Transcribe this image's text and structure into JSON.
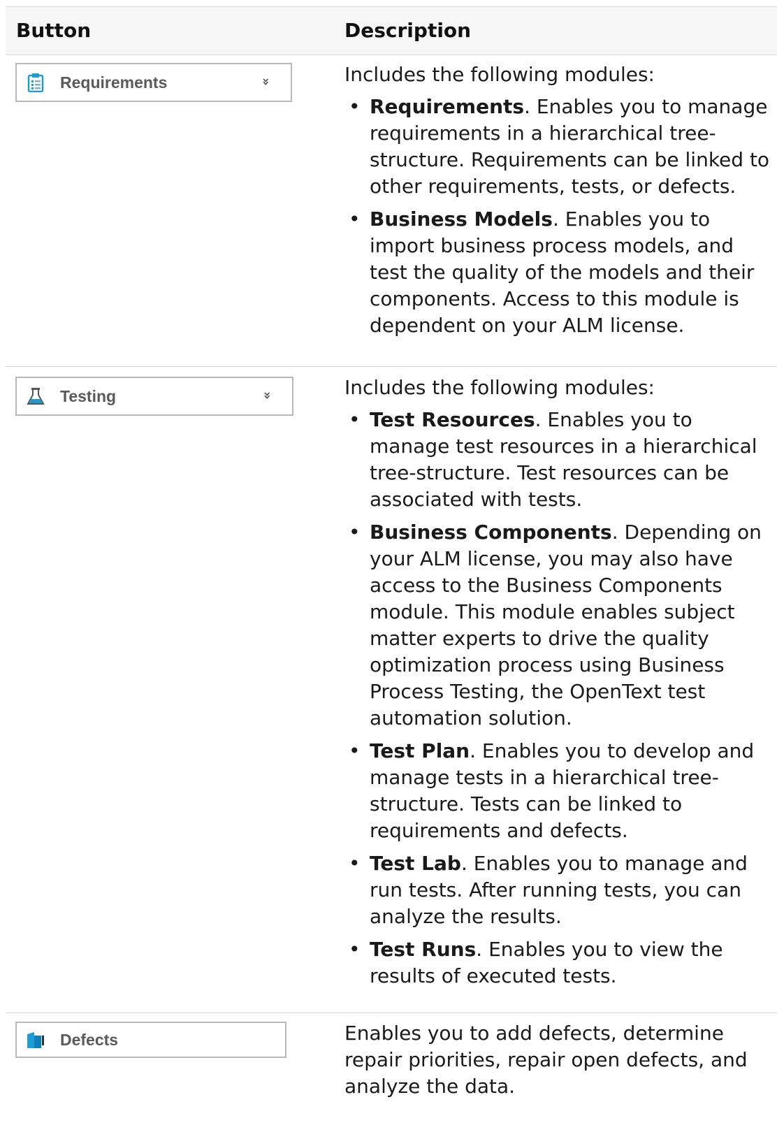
{
  "table": {
    "headers": {
      "button": "Button",
      "description": "Description"
    },
    "rows": [
      {
        "button": {
          "label": "Requirements",
          "icon": "requirements-icon",
          "has_chevron": true,
          "chevron": "»"
        },
        "intro": "Includes the following modules:",
        "items": [
          {
            "name": "Requirements",
            "text": ". Enables you to manage requirements in a hierarchical tree-structure. Requirements can be linked to other requirements, tests, or defects."
          },
          {
            "name": "Business Models",
            "text": ". Enables you to import business process models, and test the quality of the models and their components. Access to this module is dependent on your ALM license."
          }
        ]
      },
      {
        "button": {
          "label": "Testing",
          "icon": "testing-flask-icon",
          "has_chevron": true,
          "chevron": "»"
        },
        "intro": "Includes the following modules:",
        "items": [
          {
            "name": "Test Resources",
            "text": ". Enables you to manage test resources in a hierarchical tree-structure. Test resources can be associated with tests."
          },
          {
            "name": "Business Components",
            "text": ". Depending on your ALM license, you may also have access to the Business Components module. This module enables subject matter experts to drive the quality optimization process using Business Process Testing, the OpenText test automation solution."
          },
          {
            "name": "Test Plan",
            "text": ". Enables you to develop and manage tests in a hierarchical tree-structure. Tests can be linked to requirements and defects."
          },
          {
            "name": "Test Lab",
            "text": ". Enables you to manage and run tests. After running tests, you can analyze the results."
          },
          {
            "name": "Test Runs",
            "text": ". Enables you to view the results of executed tests."
          }
        ]
      },
      {
        "button": {
          "label": "Defects",
          "icon": "defects-icon",
          "has_chevron": false
        },
        "intro": "Enables you to add defects, determine repair priorities, repair open defects, and analyze the data.",
        "items": []
      }
    ]
  },
  "colors": {
    "header_bg": "#f6f6f6",
    "border": "#d6d6d6",
    "icon_blue": "#1c9bd6",
    "button_text": "#5a5a5a"
  }
}
